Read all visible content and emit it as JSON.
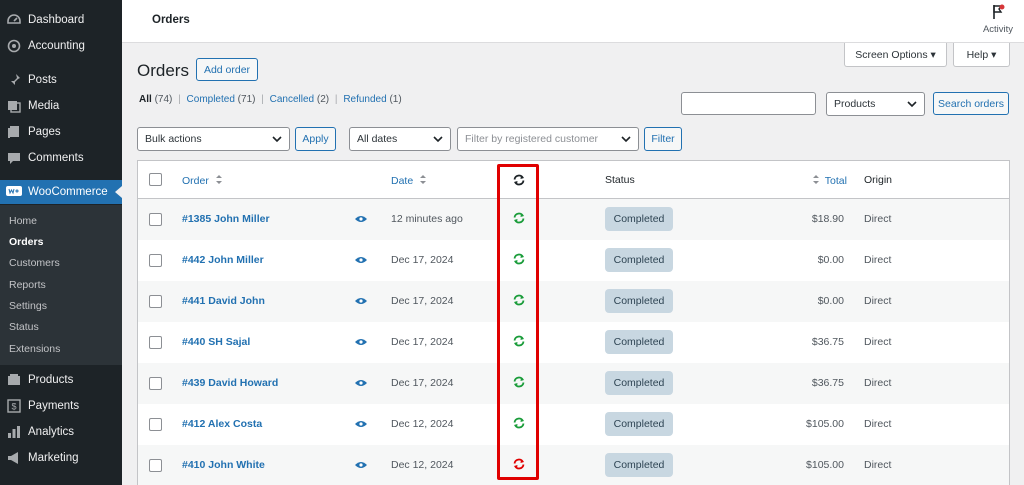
{
  "sidebar": {
    "items": [
      {
        "label": "Dashboard",
        "icon": "dashboard-icon"
      },
      {
        "label": "Accounting",
        "icon": "accounting-icon"
      },
      {
        "label": "Posts",
        "icon": "pin-icon"
      },
      {
        "label": "Media",
        "icon": "media-icon"
      },
      {
        "label": "Pages",
        "icon": "pages-icon"
      },
      {
        "label": "Comments",
        "icon": "comments-icon"
      },
      {
        "label": "WooCommerce",
        "icon": "woo-icon"
      },
      {
        "label": "Products",
        "icon": "products-icon"
      },
      {
        "label": "Payments",
        "icon": "payments-icon"
      },
      {
        "label": "Analytics",
        "icon": "analytics-icon"
      },
      {
        "label": "Marketing",
        "icon": "marketing-icon"
      }
    ],
    "submenu": [
      "Home",
      "Orders",
      "Customers",
      "Reports",
      "Settings",
      "Status",
      "Extensions"
    ]
  },
  "topbar": {
    "title": "Orders",
    "activity_label": "Activity"
  },
  "screen_options": "Screen Options ▾",
  "help": "Help ▾",
  "page": {
    "heading": "Orders",
    "add_order": "Add order"
  },
  "filters": {
    "all": "All",
    "all_count": "(74)",
    "completed": "Completed",
    "completed_count": "(71)",
    "cancelled": "Cancelled",
    "cancelled_count": "(2)",
    "refunded": "Refunded",
    "refunded_count": "(1)",
    "sep": "|"
  },
  "search": {
    "value": "",
    "type_select": "Products",
    "button": "Search orders"
  },
  "toolbar": {
    "bulk_actions": "Bulk actions",
    "apply": "Apply",
    "dates": "All dates",
    "customer_placeholder": "Filter by registered customer",
    "filter": "Filter"
  },
  "table": {
    "headers": {
      "order": "Order",
      "date": "Date",
      "status": "Status",
      "total": "Total",
      "origin": "Origin"
    },
    "rows": [
      {
        "order": "#1385 John Miller",
        "date": "12 minutes ago",
        "sync": "ok",
        "status": "Completed",
        "total": "$18.90",
        "origin": "Direct"
      },
      {
        "order": "#442 John Miller",
        "date": "Dec 17, 2024",
        "sync": "ok",
        "status": "Completed",
        "total": "$0.00",
        "origin": "Direct"
      },
      {
        "order": "#441 David John",
        "date": "Dec 17, 2024",
        "sync": "ok",
        "status": "Completed",
        "total": "$0.00",
        "origin": "Direct"
      },
      {
        "order": "#440 SH Sajal",
        "date": "Dec 17, 2024",
        "sync": "ok",
        "status": "Completed",
        "total": "$36.75",
        "origin": "Direct"
      },
      {
        "order": "#439 David Howard",
        "date": "Dec 17, 2024",
        "sync": "ok",
        "status": "Completed",
        "total": "$36.75",
        "origin": "Direct"
      },
      {
        "order": "#412 Alex Costa",
        "date": "Dec 12, 2024",
        "sync": "ok",
        "status": "Completed",
        "total": "$105.00",
        "origin": "Direct"
      },
      {
        "order": "#410 John White",
        "date": "Dec 12, 2024",
        "sync": "error",
        "status": "Completed",
        "total": "$105.00",
        "origin": "Direct"
      }
    ]
  },
  "colors": {
    "accent": "#2271b1",
    "sync_ok": "#1a9c3a",
    "sync_error": "#e00000",
    "highlight": "#e00000",
    "sidebar_bg": "#1d2327"
  }
}
